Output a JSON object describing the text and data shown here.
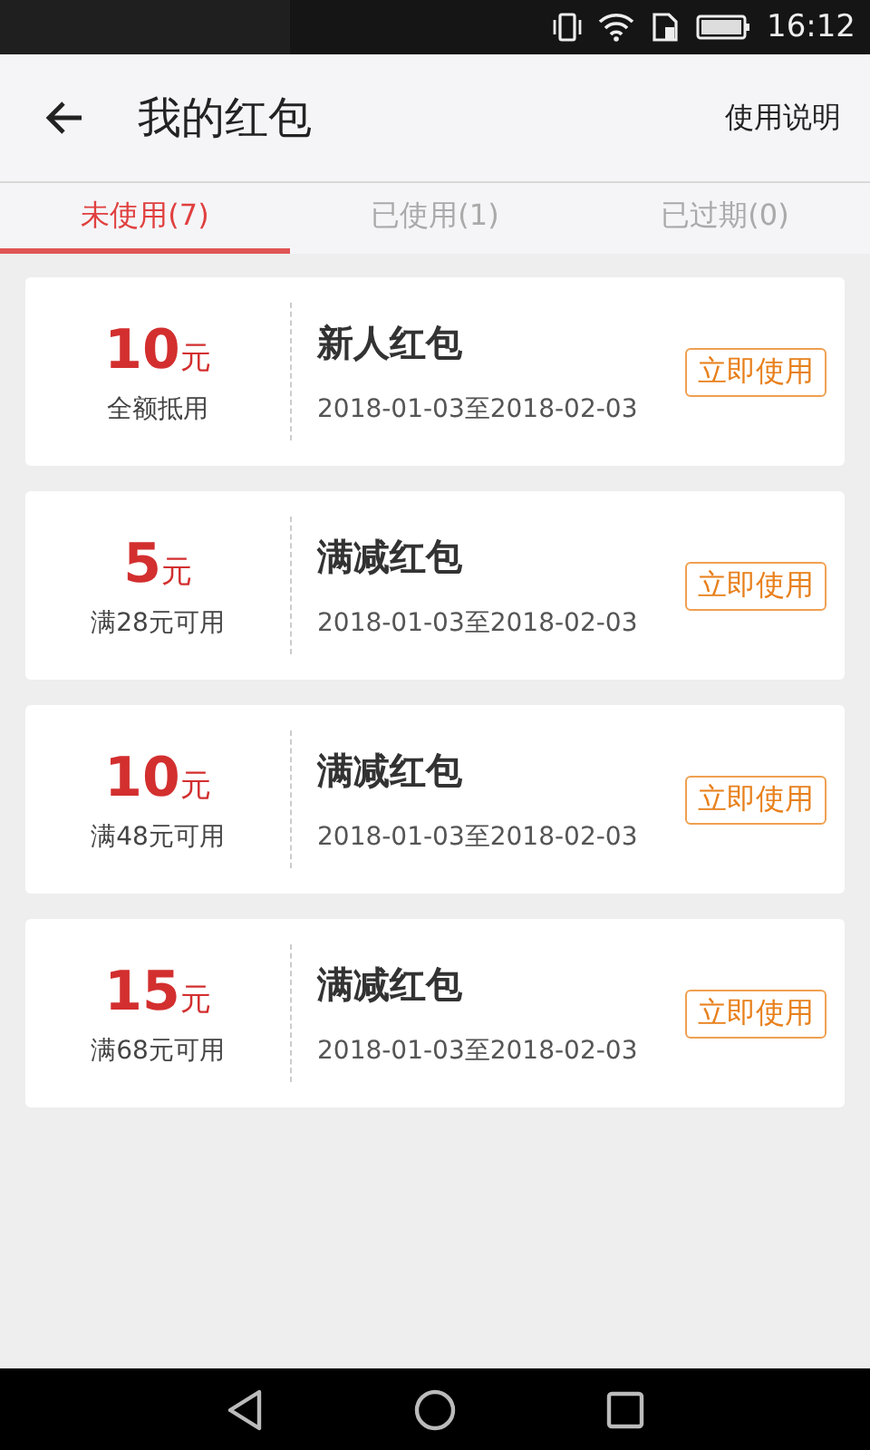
{
  "status_bar": {
    "time": "16:12"
  },
  "header": {
    "title": "我的红包",
    "action": "使用说明"
  },
  "tabs": [
    {
      "label": "未使用(7)",
      "selected": true
    },
    {
      "label": "已使用(1)",
      "selected": false
    },
    {
      "label": "已过期(0)",
      "selected": false
    }
  ],
  "coupons": [
    {
      "amount": "10",
      "unit": "元",
      "condition": "全额抵用",
      "name": "新人红包",
      "validity": "2018-01-03至2018-02-03",
      "button": "立即使用"
    },
    {
      "amount": "5",
      "unit": "元",
      "condition": "满28元可用",
      "name": "满减红包",
      "validity": "2018-01-03至2018-02-03",
      "button": "立即使用"
    },
    {
      "amount": "10",
      "unit": "元",
      "condition": "满48元可用",
      "name": "满减红包",
      "validity": "2018-01-03至2018-02-03",
      "button": "立即使用"
    },
    {
      "amount": "15",
      "unit": "元",
      "condition": "满68元可用",
      "name": "满减红包",
      "validity": "2018-01-03至2018-02-03",
      "button": "立即使用"
    }
  ]
}
